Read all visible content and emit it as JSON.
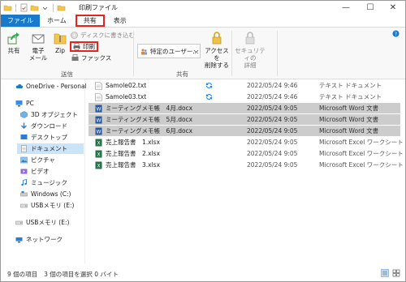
{
  "window": {
    "title": "印刷ファイル",
    "controls": {
      "minimize": "—",
      "maximize": "☐",
      "close": "✕"
    }
  },
  "ribbon_tabs": [
    "ファイル",
    "ホーム",
    "共有",
    "表示"
  ],
  "ribbon": {
    "share_label": "共有",
    "email_label_1": "電子",
    "email_label_2": "メール",
    "zip_label": "Zip",
    "burn_label": "ディスクに書き込む",
    "print_label": "印刷",
    "fax_label": "ファックス",
    "send_group_label": "送信",
    "specific_users_label": "特定のユーザー...",
    "access_removal_label_1": "アクセスを",
    "access_removal_label_2": "削除する",
    "security_label_1": "セキュリティの",
    "security_label_2": "詳細",
    "share_group_label": "共有"
  },
  "nav": {
    "items": [
      {
        "label": "OneDrive - Personal",
        "icon": "cloud-icon"
      },
      {
        "label": "PC",
        "icon": "pc-icon"
      },
      {
        "label": "3D オブジェクト",
        "icon": "3d-objects-icon"
      },
      {
        "label": "ダウンロード",
        "icon": "download-icon"
      },
      {
        "label": "デスクトップ",
        "icon": "desktop-icon"
      },
      {
        "label": "ドキュメント",
        "icon": "documents-icon"
      },
      {
        "label": "ピクチャ",
        "icon": "pictures-icon"
      },
      {
        "label": "ビデオ",
        "icon": "video-icon"
      },
      {
        "label": "ミュージック",
        "icon": "music-icon"
      },
      {
        "label": "Windows (C:)",
        "icon": "drive-icon"
      },
      {
        "label": "USBメモリ (E:)",
        "icon": "usb-drive-icon"
      },
      {
        "label": "USBメモリ (E:)",
        "icon": "usb-drive-icon"
      },
      {
        "label": "ネットワーク",
        "icon": "network-icon"
      }
    ]
  },
  "files": [
    {
      "name": "Samole02.txt",
      "date": "2022/05/24 9:46",
      "type": "テキスト ドキュメント",
      "kind": "txt",
      "selected": false
    },
    {
      "name": "Samole03.txt",
      "date": "2022/05/24 9:46",
      "type": "テキスト ドキュメント",
      "kind": "txt",
      "selected": false
    },
    {
      "name": "ミーティングメモ帳　4月.docx",
      "date": "2022/05/24 9:05",
      "type": "Microsoft Word 文書",
      "kind": "word",
      "selected": true
    },
    {
      "name": "ミーティングメモ帳　5月.docx",
      "date": "2022/05/24 9:05",
      "type": "Microsoft Word 文書",
      "kind": "word",
      "selected": true
    },
    {
      "name": "ミーティングメモ帳　6月.docx",
      "date": "2022/05/24 9:05",
      "type": "Microsoft Word 文書",
      "kind": "word",
      "selected": true
    },
    {
      "name": "売上報告書　1.xlsx",
      "date": "2022/05/24 9:05",
      "type": "Microsoft Excel ワークシート",
      "kind": "excel",
      "selected": false
    },
    {
      "name": "売上報告書　2.xlsx",
      "date": "2022/05/24 9:05",
      "type": "Microsoft Excel ワークシート",
      "kind": "excel",
      "selected": false
    },
    {
      "name": "売上報告書　3.xlsx",
      "date": "2022/05/24 9:05",
      "type": "Microsoft Excel ワークシート",
      "kind": "excel",
      "selected": false
    }
  ],
  "status": {
    "item_count": "9 個の項目",
    "selection": "3 個の項目を選択  0 バイト"
  },
  "colors": {
    "accent": "#1979ca",
    "highlight_red": "#e8231c",
    "selection_gray": "#cccccc",
    "nav_selected": "#cce4f7",
    "sync_blue": "#2b7cd3"
  }
}
